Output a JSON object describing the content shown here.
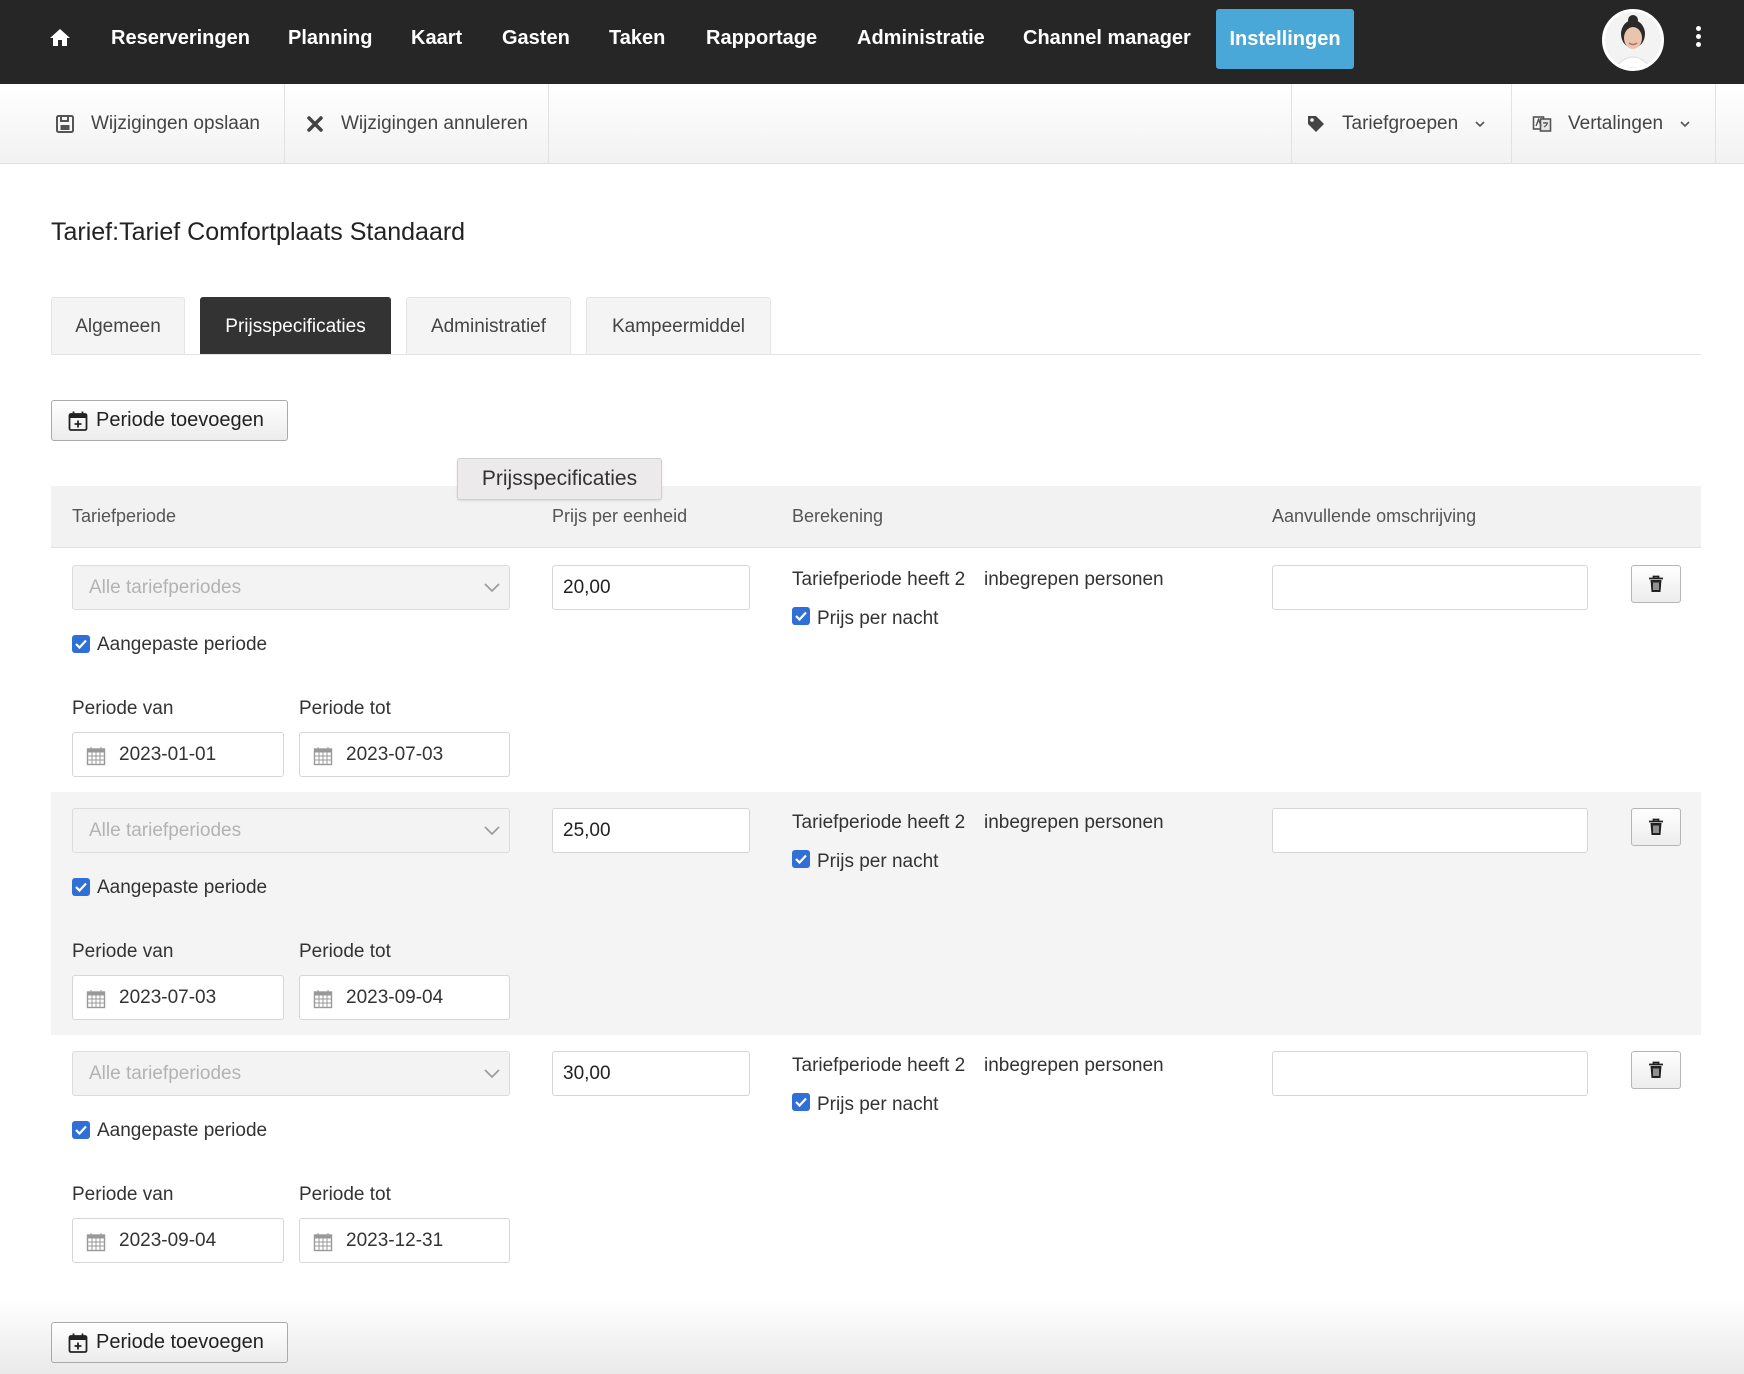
{
  "nav": {
    "home_icon": "home-icon",
    "items": [
      "Reserveringen",
      "Planning",
      "Kaart",
      "Gasten",
      "Taken",
      "Rapportage",
      "Administratie",
      "Channel manager"
    ],
    "active": "Instellingen",
    "accent": "#4aa8d8",
    "avatar_icon": "user-avatar",
    "more_icon": "kebab-icon"
  },
  "toolbar": {
    "save": "Wijzigingen opslaan",
    "cancel": "Wijzigingen annuleren",
    "tariffgroups": "Tariefgroepen",
    "translations": "Vertalingen"
  },
  "page": {
    "title": "Tarief:Tarief Comfortplaats Standaard"
  },
  "tabs": [
    "Algemeen",
    "Prijsspecificaties",
    "Administratief",
    "Kampeermiddel"
  ],
  "active_tab": "Prijsspecificaties",
  "add_period": "Periode toevoegen",
  "tooltip": "Prijsspecificaties",
  "table": {
    "headers": {
      "period": "Tariefperiode",
      "price": "Prijs per eenheid",
      "calc": "Berekening",
      "desc": "Aanvullende omschrijving"
    },
    "rows": [
      {
        "select": "Alle tariefperiodes",
        "custom_period": "Aangepaste periode",
        "from_label": "Periode van",
        "to_label": "Periode tot",
        "from": "2023-01-01",
        "to": "2023-07-03",
        "price": "20,00",
        "calc_prefix": "Tariefperiode heeft 2",
        "calc_suffix": "inbegrepen personen",
        "per_night": "Prijs per nacht",
        "description": ""
      },
      {
        "select": "Alle tariefperiodes",
        "custom_period": "Aangepaste periode",
        "from_label": "Periode van",
        "to_label": "Periode tot",
        "from": "2023-07-03",
        "to": "2023-09-04",
        "price": "25,00",
        "calc_prefix": "Tariefperiode heeft 2",
        "calc_suffix": "inbegrepen personen",
        "per_night": "Prijs per nacht",
        "description": ""
      },
      {
        "select": "Alle tariefperiodes",
        "custom_period": "Aangepaste periode",
        "from_label": "Periode van",
        "to_label": "Periode tot",
        "from": "2023-09-04",
        "to": "2023-12-31",
        "price": "30,00",
        "calc_prefix": "Tariefperiode heeft 2",
        "calc_suffix": "inbegrepen personen",
        "per_night": "Prijs per nacht",
        "description": ""
      }
    ]
  }
}
